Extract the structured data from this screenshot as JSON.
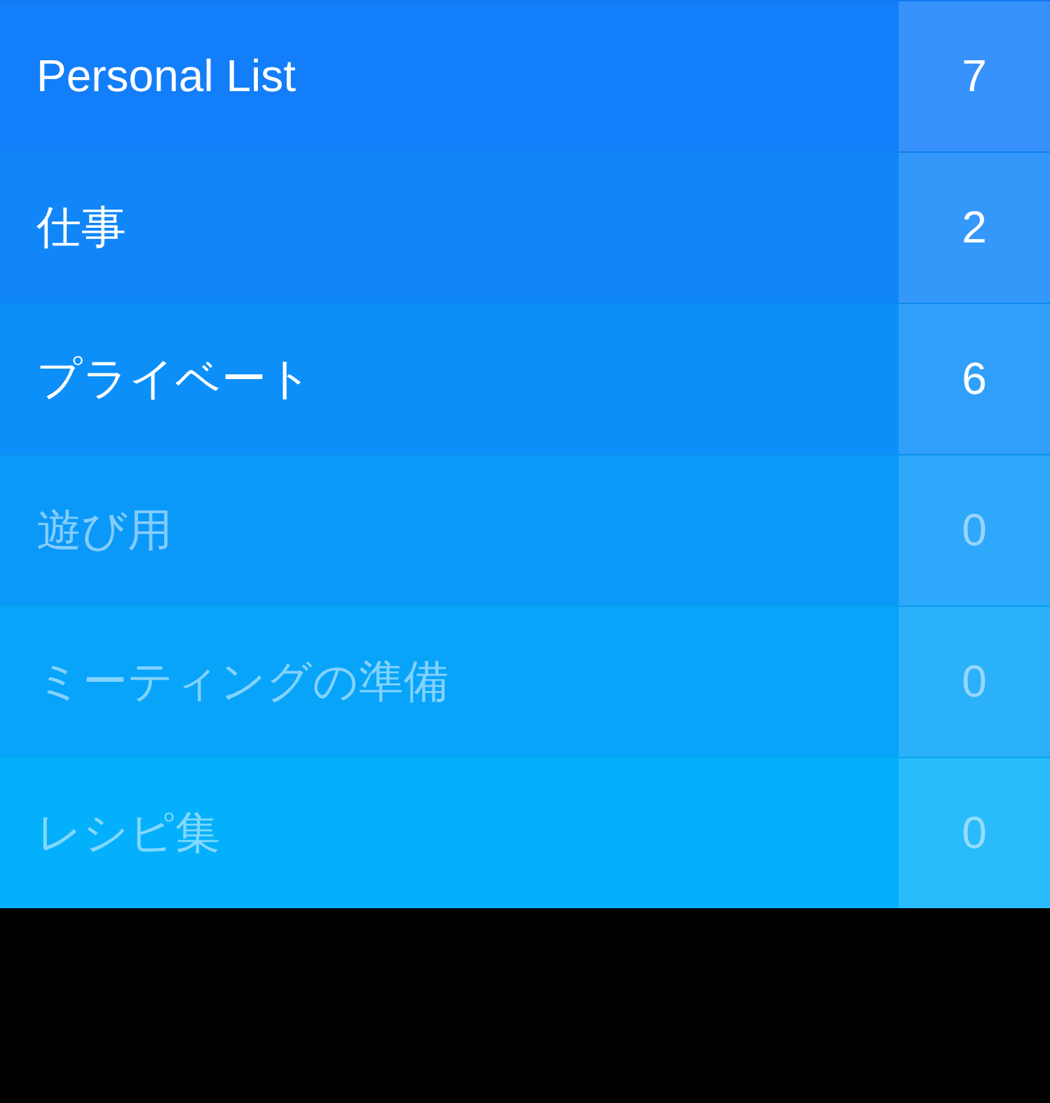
{
  "lists": [
    {
      "name": "Personal List",
      "count": "7",
      "dimmed": false,
      "color": "#137ef9"
    },
    {
      "name": "仕事",
      "count": "2",
      "dimmed": false,
      "color": "#1086f9"
    },
    {
      "name": "プライベート",
      "count": "6",
      "dimmed": false,
      "color": "#0c8ff9"
    },
    {
      "name": "遊び用",
      "count": "0",
      "dimmed": true,
      "color": "#0a99f9"
    },
    {
      "name": "ミーティングの準備",
      "count": "0",
      "dimmed": true,
      "color": "#07a4fa"
    },
    {
      "name": "レシピ集",
      "count": "0",
      "dimmed": true,
      "color": "#04b0fb"
    }
  ]
}
